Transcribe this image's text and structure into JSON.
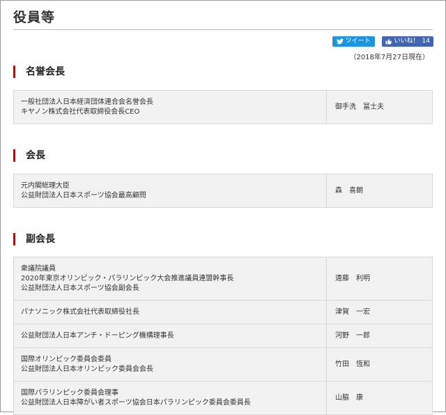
{
  "page": {
    "title": "役員等"
  },
  "social": {
    "tweet_label": "ツイート",
    "like_label": "いいね！",
    "like_count": "14"
  },
  "as_of": "（2018年7月27日現在）",
  "sections": [
    {
      "heading": "名誉会長",
      "rows": [
        {
          "roles": [
            "一般社団法人日本経済団体連合会名誉会長",
            "キヤノン株式会社代表取締役会長CEO"
          ],
          "name": "御手洗　冨士夫"
        }
      ]
    },
    {
      "heading": "会長",
      "rows": [
        {
          "roles": [
            "元内閣総理大臣",
            "公益財団法人日本スポーツ協会最高顧問"
          ],
          "name": "森　喜朗"
        }
      ]
    },
    {
      "heading": "副会長",
      "rows": [
        {
          "roles": [
            "衆議院議員",
            "2020年東京オリンピック・パラリンピック大会推進議員連盟幹事長",
            "公益財団法人日本スポーツ協会副会長"
          ],
          "name": "遠藤　利明"
        },
        {
          "roles": [
            "パナソニック株式会社代表取締役社長"
          ],
          "name": "津賀　一宏"
        },
        {
          "roles": [
            "公益財団法人日本アンチ・ドーピング機構理事長"
          ],
          "name": "河野　一郎"
        },
        {
          "roles": [
            "国際オリンピック委員会委員",
            "公益財団法人日本オリンピック委員会会長"
          ],
          "name": "竹田　恆和"
        },
        {
          "roles": [
            "国際パラリンピック委員会理事",
            "公益財団法人日本障がい者スポーツ協会日本パラリンピック委員会委員長"
          ],
          "name": "山脇　康"
        }
      ]
    }
  ]
}
